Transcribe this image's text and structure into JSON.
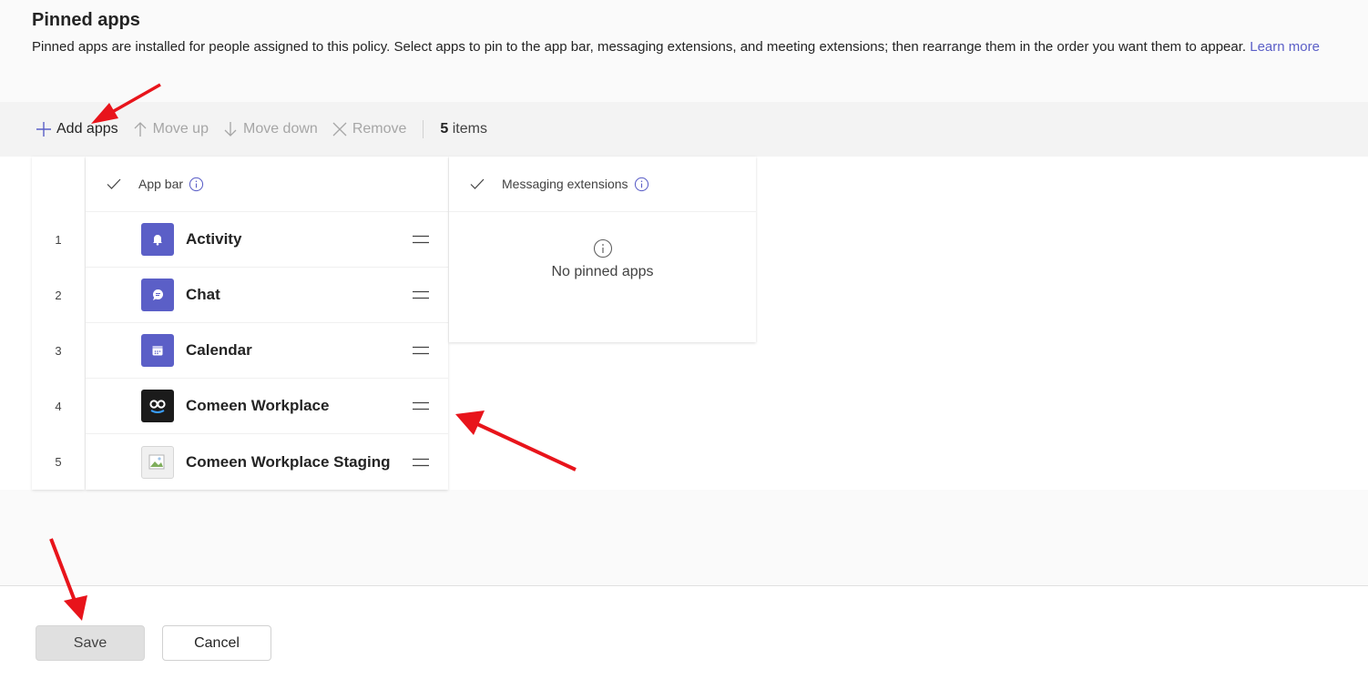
{
  "section": {
    "title": "Pinned apps",
    "description": "Pinned apps are installed for people assigned to this policy. Select apps to pin to the app bar, messaging extensions, and meeting extensions; then rearrange them in the order you want them to appear.",
    "learn_more": "Learn more"
  },
  "toolbar": {
    "add_apps": "Add apps",
    "move_up": "Move up",
    "move_down": "Move down",
    "remove": "Remove",
    "count_number": "5",
    "count_label": "items"
  },
  "app_bar": {
    "header": "App bar",
    "rows": [
      {
        "index": "1",
        "name": "Activity",
        "icon": "bell-icon",
        "icon_bg": "#5b5fc7"
      },
      {
        "index": "2",
        "name": "Chat",
        "icon": "chat-icon",
        "icon_bg": "#5b5fc7"
      },
      {
        "index": "3",
        "name": "Calendar",
        "icon": "calendar-icon",
        "icon_bg": "#5b5fc7"
      },
      {
        "index": "4",
        "name": "Comeen Workplace",
        "icon": "comeen-logo-icon",
        "icon_bg": "#1b1b1b"
      },
      {
        "index": "5",
        "name": "Comeen Workplace Staging",
        "icon": "broken-image-icon",
        "icon_bg": "#f0f0f0"
      }
    ]
  },
  "messaging_extensions": {
    "header": "Messaging extensions",
    "empty_text": "No pinned apps"
  },
  "footer": {
    "save": "Save",
    "cancel": "Cancel"
  },
  "colors": {
    "accent": "#5b5fc7",
    "annotation_arrow": "#e8141b"
  }
}
